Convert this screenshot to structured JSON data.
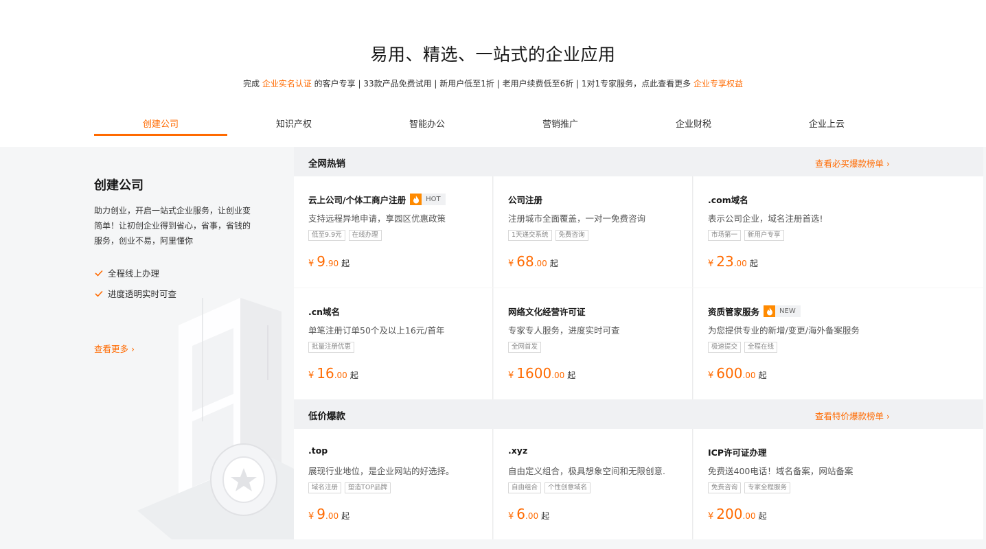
{
  "header": {
    "title": "易用、精选、一站式的企业应用",
    "subtitle_prefix": "完成",
    "subtitle_link1": "企业实名认证",
    "subtitle_middle": "的客户专享 | 33款产品免费试用 | 新用户低至1折 | 老用户续费低至6折 | 1对1专家服务，点此查看更多",
    "subtitle_link2": "企业专享权益"
  },
  "tabs": [
    "创建公司",
    "知识产权",
    "智能办公",
    "营销推广",
    "企业财税",
    "企业上云"
  ],
  "active_tab": 0,
  "left_panel": {
    "title": "创建公司",
    "desc": "助力创业，开启一站式企业服务，让创业变简单！让初创企业得到省心，省事，省钱的服务，创业不易，阿里懂你",
    "checks": [
      "全程线上办理",
      "进度透明实时可查"
    ],
    "more": "查看更多 ›"
  },
  "sections": [
    {
      "title": "全网热销",
      "link": "查看必买爆款榜单 ›",
      "cards": [
        {
          "name": "云上公司/个体工商户注册",
          "badge": "HOT",
          "desc": "支持远程异地申请，享园区优惠政策",
          "tags": [
            "低至9.9元",
            "在线办理"
          ],
          "price_int": "9",
          "price_dec": ".90"
        },
        {
          "name": "公司注册",
          "badge": "",
          "desc": "注册城市全面覆盖，一对一免费咨询",
          "tags": [
            "1天递交系统",
            "免费咨询"
          ],
          "price_int": "68",
          "price_dec": ".00"
        },
        {
          "name": ".com域名",
          "badge": "",
          "desc": "表示公司企业，域名注册首选!",
          "tags": [
            "市场第一",
            "新用户专享"
          ],
          "price_int": "23",
          "price_dec": ".00"
        },
        {
          "name": ".cn域名",
          "badge": "",
          "desc": "单笔注册订单50个及以上16元/首年",
          "tags": [
            "批量注册优惠"
          ],
          "price_int": "16",
          "price_dec": ".00"
        },
        {
          "name": "网络文化经营许可证",
          "badge": "",
          "desc": "专家专人服务，进度实时可查",
          "tags": [
            "全网首发"
          ],
          "price_int": "1600",
          "price_dec": ".00"
        },
        {
          "name": "资质管家服务",
          "badge": "NEW",
          "desc": "为您提供专业的新增/变更/海外备案服务",
          "tags": [
            "极速提交",
            "全程在线"
          ],
          "price_int": "600",
          "price_dec": ".00"
        }
      ]
    },
    {
      "title": "低价爆款",
      "link": "查看特价爆款榜单 ›",
      "cards": [
        {
          "name": ".top",
          "badge": "",
          "desc": "展现行业地位，是企业网站的好选择。",
          "tags": [
            "域名注册",
            "塑造TOP品牌"
          ],
          "price_int": "9",
          "price_dec": ".00"
        },
        {
          "name": ".xyz",
          "badge": "",
          "desc": "自由定义组合，极具想象空间和无限创意.",
          "tags": [
            "自由组合",
            "个性创意域名"
          ],
          "price_int": "6",
          "price_dec": ".00"
        },
        {
          "name": "ICP许可证办理",
          "badge": "",
          "desc": "免费送400电话！域名备案，网站备案",
          "tags": [
            "免费咨询",
            "专家全程服务"
          ],
          "price_int": "200",
          "price_dec": ".00"
        }
      ]
    }
  ],
  "price_labels": {
    "yen": "¥",
    "qi": "起"
  },
  "colors": {
    "accent": "#ff6a00",
    "badge_fire": "#ff8a00",
    "band_bg": "#f5f6f7"
  }
}
